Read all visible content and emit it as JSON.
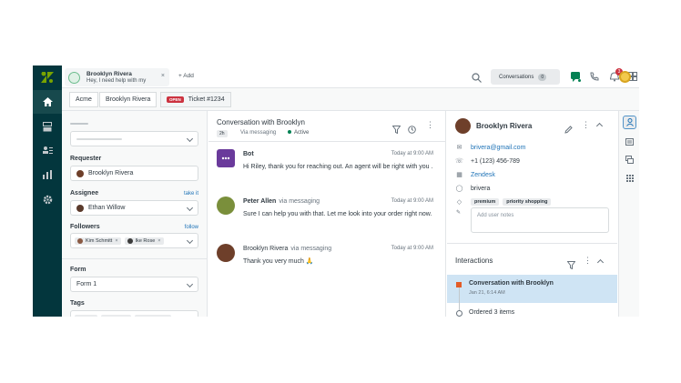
{
  "nav": {
    "items": [
      {
        "name": "home",
        "icon": "home-icon"
      },
      {
        "name": "views",
        "icon": "inbox-icon"
      },
      {
        "name": "customers",
        "icon": "contacts-icon"
      },
      {
        "name": "reporting",
        "icon": "bar-chart-icon"
      },
      {
        "name": "admin",
        "icon": "gear-icon"
      }
    ]
  },
  "topbar": {
    "tab": {
      "title": "Brooklyn Rivera",
      "subtitle": "Hey, I need help with my",
      "close": "×"
    },
    "add_label": "+ Add",
    "conversations_label": "Conversations",
    "conversations_count": "0",
    "notification_count": "3"
  },
  "breadcrumb": {
    "org": "Acme",
    "requester": "Brooklyn Rivera",
    "status_badge": "OPEN",
    "ticket": "Ticket #1234"
  },
  "properties": {
    "requester_label": "Requester",
    "requester_value": "Brooklyn Rivera",
    "assignee_label": "Assignee",
    "assignee_link": "take it",
    "assignee_value": "Ethan Willow",
    "followers_label": "Followers",
    "followers_link": "follow",
    "followers": [
      "Kim Schmitt",
      "Ike Rose"
    ],
    "form_label": "Form",
    "form_value": "Form 1",
    "tags_label": "Tags"
  },
  "conversation": {
    "title": "Conversation with Brooklyn",
    "badge": "2h",
    "via": "Via messaging",
    "status": "Active",
    "messages": [
      {
        "name": "Bot",
        "via": "",
        "time": "Today at 9:00 AM",
        "text": "Hi Riley, thank you for reaching out. An agent will be right with you ."
      },
      {
        "name": "Peter Allen",
        "via": "via messaging",
        "time": "Today at 9:00 AM",
        "text": "Sure I can help you with that. Let me look into your order right now."
      },
      {
        "name": "Brooklyn Rivera",
        "via": "via messaging",
        "time": "Today at 9:00 AM",
        "text": "Thank you very much 🙏"
      }
    ]
  },
  "requester": {
    "name": "Brooklyn Rivera",
    "email": "brivera@gmail.com",
    "phone": "+1 (123) 456-789",
    "org": "Zendesk",
    "whatsapp": "brivera",
    "tags": [
      "premium",
      "priority shopping"
    ],
    "notes_placeholder": "Add user notes",
    "interactions_title": "Interactions",
    "interactions": [
      {
        "title": "Conversation with Brooklyn",
        "date": "Jan 21, 6:14 AM"
      },
      {
        "title": "Ordered 3 items",
        "date": ""
      }
    ]
  },
  "colors": {
    "nav_bg": "#03363d",
    "accent_blue": "#1f73b7",
    "open_red": "#cc3340",
    "active_green": "#038153",
    "selected_row": "#cfe4f4"
  }
}
